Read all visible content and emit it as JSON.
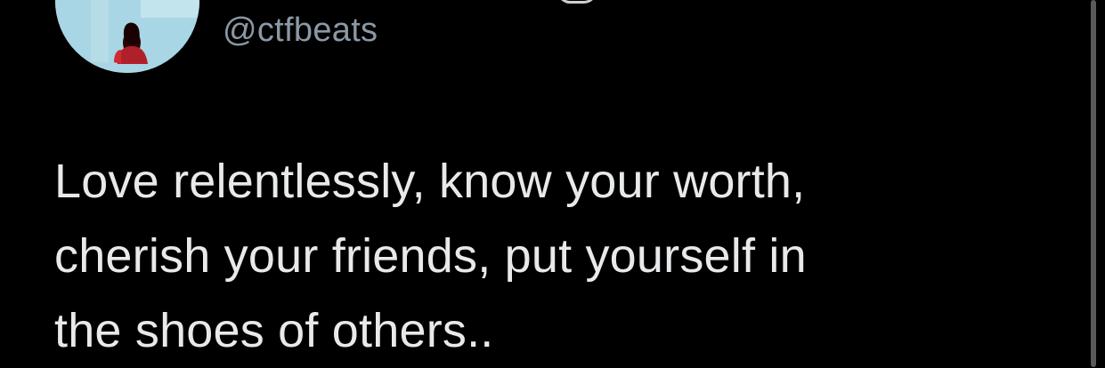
{
  "tweet": {
    "handle": "@ctfbeats",
    "text_lines": [
      "Love relentlessly, know your worth,",
      "cherish your friends, put yourself in",
      "the shoes of others.."
    ]
  },
  "avatar": {
    "icon": "profile-photo-silhouette"
  },
  "colors": {
    "background": "#000000",
    "text": "#e7e9ea",
    "handle": "#8b98a5",
    "avatar_bg": "#a9d6e5",
    "figure": "#b0202a"
  }
}
